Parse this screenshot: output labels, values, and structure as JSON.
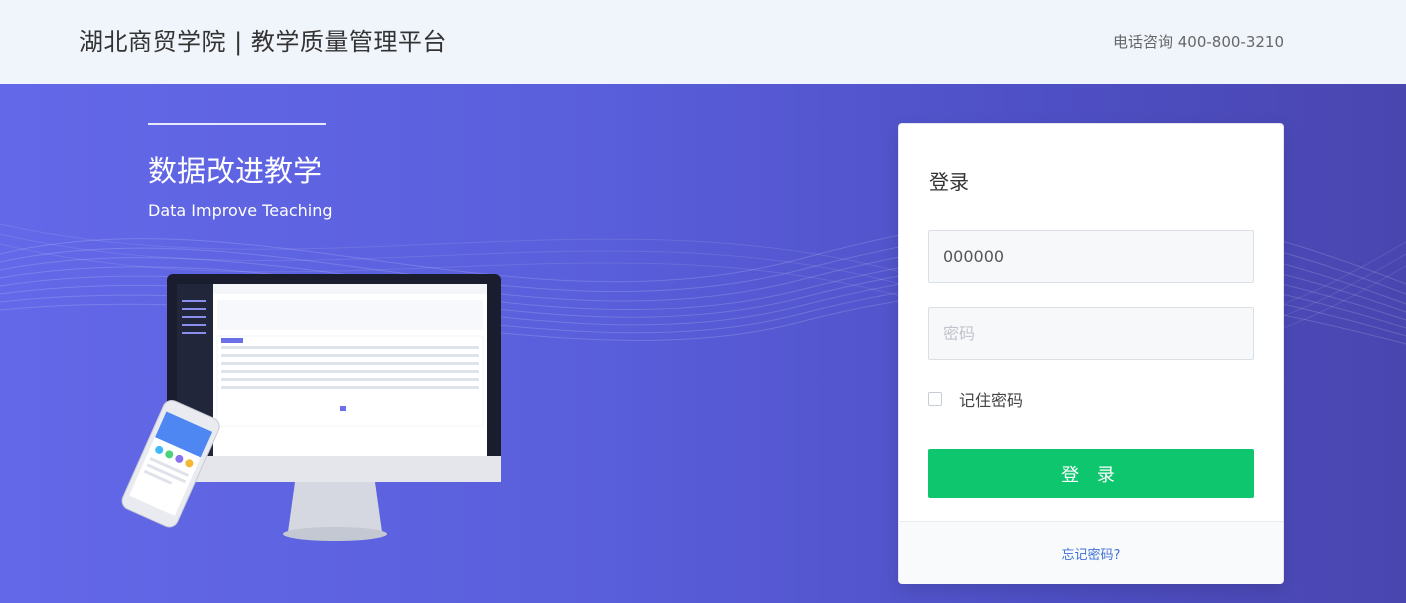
{
  "header": {
    "brand": "湖北商贸学院 | 教学质量管理平台",
    "hotline": "电话咨询 400-800-3210"
  },
  "hero": {
    "slogan": "数据改进教学",
    "slogan_en": "Data Improve Teaching"
  },
  "login": {
    "title": "登录",
    "username_value": "000000",
    "password_placeholder": "密码",
    "remember_label": "记住密码",
    "remember_checked": false,
    "submit_label": "登 录",
    "forgot_label": "忘记密码?"
  },
  "colors": {
    "primary_button": "#0ec66d",
    "hero_gradient_start": "#6368e8",
    "hero_gradient_end": "#4a46b0",
    "link": "#3e71d6",
    "topbar_bg": "#f0f4fb"
  }
}
